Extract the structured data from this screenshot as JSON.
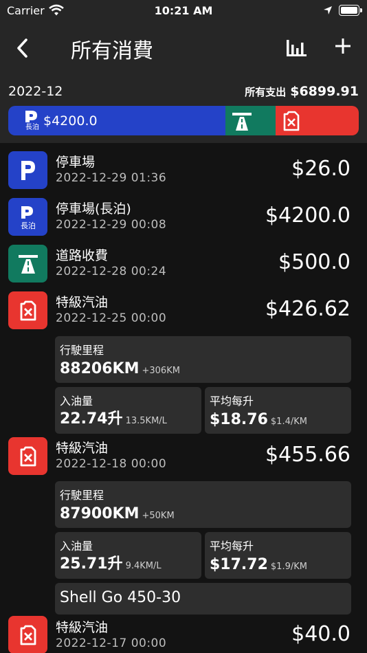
{
  "status": {
    "carrier": "Carrier",
    "time": "10:21 AM"
  },
  "nav": {
    "title": "所有消費"
  },
  "summary": {
    "month": "2022-12",
    "total_label": "所有支出",
    "total": "$6899.91",
    "parking_amount": "$4200.0",
    "parking_sub": "長泊"
  },
  "entries": [
    {
      "title": "停車場",
      "date": "2022-12-29 01:36",
      "amount": "$26.0"
    },
    {
      "title": "停車場(長泊)",
      "date": "2022-12-29 00:08",
      "amount": "$4200.0",
      "icon_sub": "長泊"
    },
    {
      "title": "道路收費",
      "date": "2022-12-28 00:24",
      "amount": "$500.0"
    },
    {
      "title": "特級汽油",
      "date": "2022-12-25 00:00",
      "amount": "$426.62",
      "mileage_label": "行駛里程",
      "mileage": "88206KM",
      "mileage_diff": "+306KM",
      "fuel_label": "入油量",
      "fuel": "22.74升",
      "efficiency": "13.5KM/L",
      "avg_label": "平均每升",
      "avg": "$18.76",
      "per_km": "$1.4/KM"
    },
    {
      "title": "特級汽油",
      "date": "2022-12-18 00:00",
      "amount": "$455.66",
      "mileage_label": "行駛里程",
      "mileage": "87900KM",
      "mileage_diff": "+50KM",
      "fuel_label": "入油量",
      "fuel": "25.71升",
      "efficiency": "9.4KM/L",
      "avg_label": "平均每升",
      "avg": "$17.72",
      "per_km": "$1.9/KM",
      "note": "Shell Go 450-30"
    },
    {
      "title": "特級汽油",
      "date": "2022-12-17 00:00",
      "amount": "$40.0"
    }
  ],
  "icons": {
    "parking": "parking-icon",
    "long_parking": "long-term-parking-icon",
    "toll": "highway-toll-icon",
    "fuel": "fuel-can-icon"
  },
  "colors": {
    "parking": "#2442c8",
    "toll": "#117a5f",
    "fuel": "#e8352f"
  }
}
